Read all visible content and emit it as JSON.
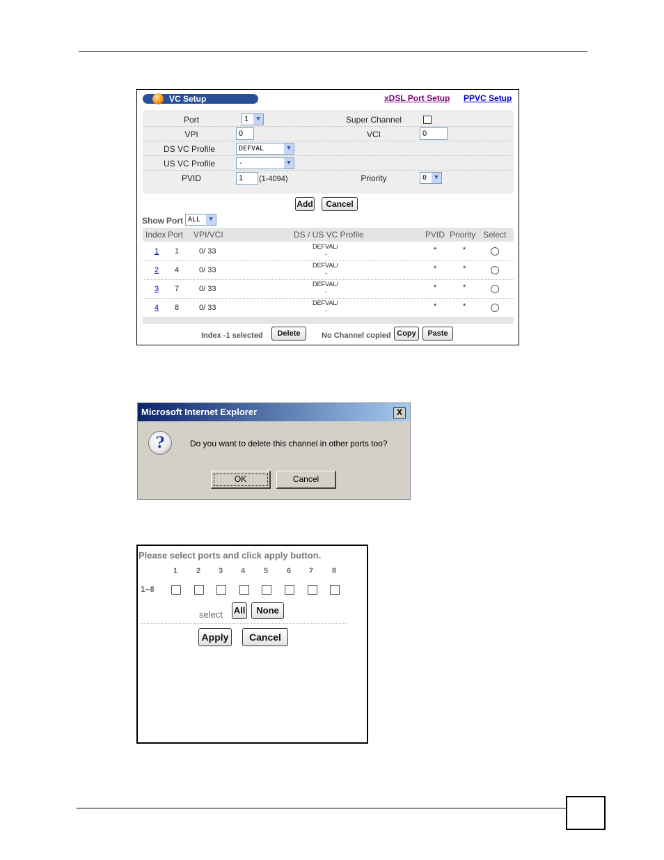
{
  "vc_setup": {
    "title": "VC Setup",
    "links": {
      "xdsl": "xDSL Port Setup",
      "ppvc": "PPVC Setup"
    },
    "form": {
      "port_label": "Port",
      "port_value": "1",
      "super_channel_label": "Super Channel",
      "vpi_label": "VPI",
      "vpi_value": "0",
      "vci_label": "VCI",
      "vci_value": "0",
      "ds_profile_label": "DS VC Profile",
      "ds_profile_value": "DEFVAL",
      "us_profile_label": "US VC Profile",
      "us_profile_value": "-",
      "pvid_label": "PVID",
      "pvid_value": "1",
      "pvid_range": "(1-4094)",
      "priority_label": "Priority",
      "priority_value": "0"
    },
    "buttons": {
      "add": "Add",
      "cancel": "Cancel",
      "delete": "Delete",
      "copy": "Copy",
      "paste": "Paste"
    },
    "show_label": "Show",
    "show_port_label": "Port",
    "show_port_value": "ALL",
    "table": {
      "headers": [
        "Index",
        "Port",
        "VPI/VCI",
        "DS / US VC Profile",
        "PVID",
        "Priority",
        "Select"
      ],
      "rows": [
        {
          "index": "1",
          "port": "1",
          "vpivci": "0/ 33",
          "ds": "DEFVAL/",
          "us": "-",
          "pvid": "*",
          "priority": "*"
        },
        {
          "index": "2",
          "port": "4",
          "vpivci": "0/ 33",
          "ds": "DEFVAL/",
          "us": "-",
          "pvid": "*",
          "priority": "*"
        },
        {
          "index": "3",
          "port": "7",
          "vpivci": "0/ 33",
          "ds": "DEFVAL/",
          "us": "-",
          "pvid": "*",
          "priority": "*"
        },
        {
          "index": "4",
          "port": "8",
          "vpivci": "0/ 33",
          "ds": "DEFVAL/",
          "us": "-",
          "pvid": "*",
          "priority": "*"
        }
      ]
    },
    "footer": {
      "selected_text": "Index -1 selected",
      "copied_text": "No Channel copied"
    }
  },
  "dialog": {
    "title": "Microsoft Internet Explorer",
    "close": "X",
    "message": "Do you want to delete this channel in other ports too?",
    "ok": "OK",
    "cancel": "Cancel"
  },
  "port_select": {
    "prompt": "Please select ports and click apply button.",
    "numbers": [
      "1",
      "2",
      "3",
      "4",
      "5",
      "6",
      "7",
      "8"
    ],
    "range_label": "1~8",
    "select_label": "select",
    "all": "All",
    "none": "None",
    "apply": "Apply",
    "cancel": "Cancel"
  },
  "colors": {
    "pill_blue": "#2a4f9a",
    "link_purple": "#800080",
    "link_blue": "#0000cc",
    "dialog_title": "#0a246a"
  }
}
